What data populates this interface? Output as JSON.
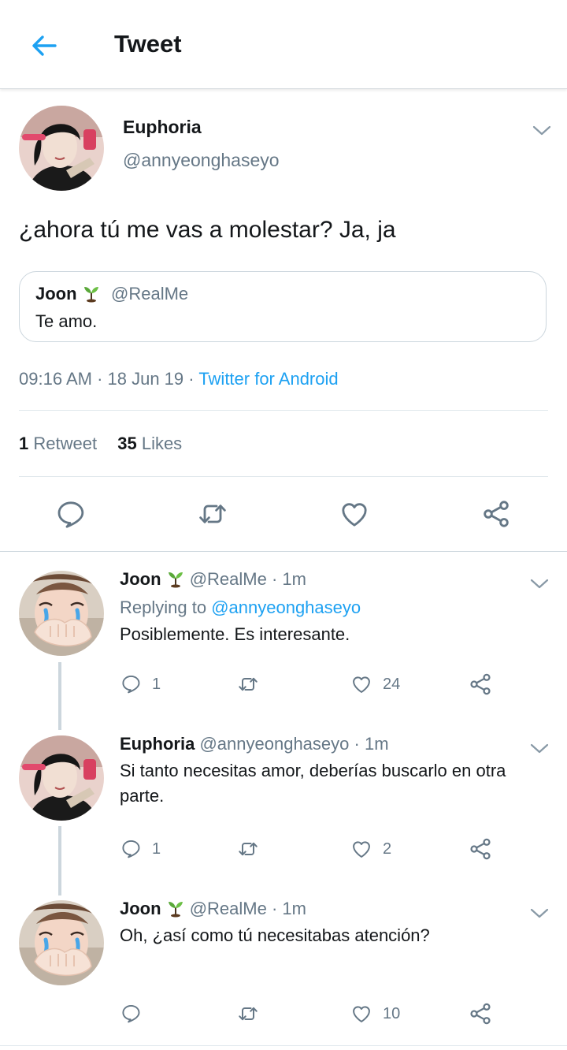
{
  "header": {
    "title": "Tweet",
    "back_icon": "arrow-left-icon"
  },
  "colors": {
    "accent": "#1da1f2",
    "secondary_text": "#657786",
    "border": "#e1e8ed"
  },
  "tweet": {
    "author_name": "Euphoria",
    "author_handle": "@annyeonghaseyo",
    "text": "¿ahora tú me vas a molestar? Ja, ja",
    "quote": {
      "name": "Joon",
      "emoji": "seedling-emoji",
      "handle": "@RealMe",
      "text": "Te amo."
    },
    "time": "09:16 AM",
    "date": "18 Jun 19",
    "client": "Twitter for Android",
    "retweet_count": "1",
    "retweet_label": "Retweet",
    "like_count": "35",
    "like_label": "Likes"
  },
  "actions": [
    "reply-icon",
    "retweet-icon",
    "like-icon",
    "share-icon"
  ],
  "replies": [
    {
      "name": "Joon",
      "handle": "@RealMe",
      "time": "1m",
      "replying_prefix": "Replying to",
      "replying_to": "@annyeonghaseyo",
      "text": "Posiblemente. Es interesante.",
      "reply_count": "1",
      "like_count": "24"
    },
    {
      "name": "Euphoria",
      "handle": "@annyeonghaseyo",
      "time": "1m",
      "text": "Si tanto necesitas amor, deberías buscarlo en otra parte.",
      "reply_count": "1",
      "like_count": "2"
    },
    {
      "name": "Joon",
      "handle": "@RealMe",
      "time": "1m",
      "text": "Oh, ¿así como tú necesitabas atención?",
      "reply_count": "",
      "like_count": "10"
    }
  ]
}
